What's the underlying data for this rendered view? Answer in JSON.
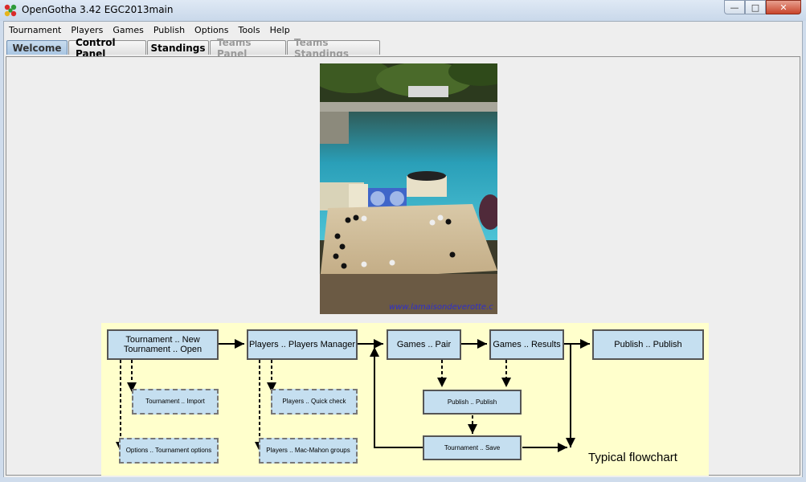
{
  "window": {
    "title": "OpenGotha 3.42 EGC2013main"
  },
  "menu": [
    "Tournament",
    "Players",
    "Games",
    "Publish",
    "Options",
    "Tools",
    "Help"
  ],
  "tabs": [
    {
      "label": "Welcome",
      "state": "active"
    },
    {
      "label": "Control Panel",
      "state": "normal"
    },
    {
      "label": "Standings",
      "state": "normal"
    },
    {
      "label": "Teams Panel",
      "state": "disabled"
    },
    {
      "label": "Teams Standings",
      "state": "disabled"
    }
  ],
  "photo": {
    "watermark": "www.lamaisondeverotte.c"
  },
  "flowchart": {
    "nodes": {
      "t_new": "Tournament .. New\nTournament .. Open",
      "p_mgr": "Players .. Players Manager",
      "g_pair": "Games .. Pair",
      "g_res": "Games .. Results",
      "pub1": "Publish .. Publish",
      "t_import": "Tournament .. Import",
      "p_quick": "Players .. Quick check",
      "pub2": "Publish .. Publish",
      "o_opts": "Options .. Tournament options",
      "p_mm": "Players .. Mac-Mahon groups",
      "t_save": "Tournament .. Save"
    },
    "caption": "Typical flowchart"
  },
  "colors": {
    "tab_active": "#b8d1ea",
    "node_fill": "#c5dff0",
    "flow_bg": "#ffffcc"
  }
}
